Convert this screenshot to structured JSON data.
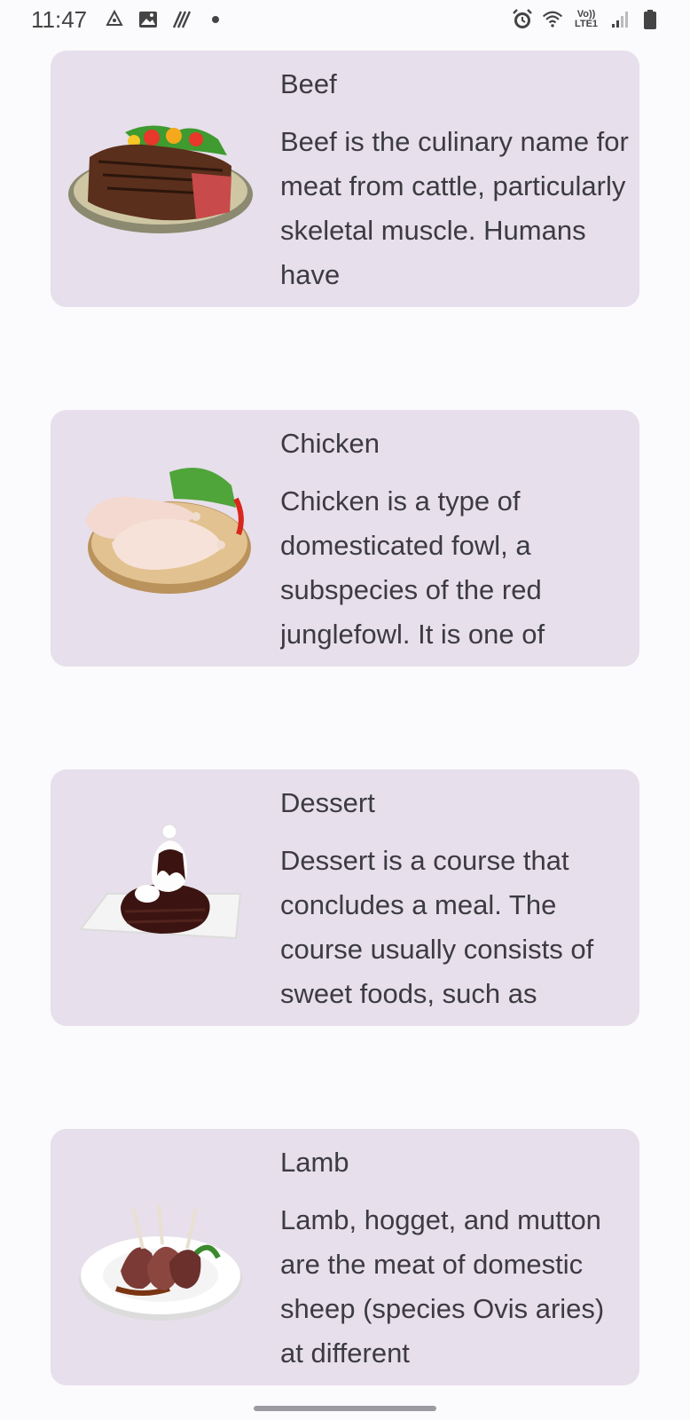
{
  "status_bar": {
    "time": "11:47",
    "left_icons": [
      "recycle-icon",
      "gallery-icon",
      "no-sim-icon",
      "dot-icon"
    ],
    "right_icons": [
      "alarm-icon",
      "wifi-icon",
      "volte-icon",
      "signal-icon",
      "battery-icon"
    ],
    "volte_label": "Vo))",
    "lte_label": "LTE1"
  },
  "cards": [
    {
      "title": "Beef",
      "description": "Beef is the culinary name for meat from cattle, particularly skeletal muscle. Humans have",
      "image": "beef-steak-image"
    },
    {
      "title": "Chicken",
      "description": "Chicken is a type of domesticated fowl, a subspecies of the red junglefowl. It is one of",
      "image": "chicken-legs-image"
    },
    {
      "title": "Dessert",
      "description": "Dessert is a course that concludes a meal. The course usually consists of sweet foods, such as",
      "image": "chocolate-dessert-image"
    },
    {
      "title": "Lamb",
      "description": "Lamb, hogget, and mutton are the meat of domestic sheep (species Ovis aries) at different",
      "image": "lamb-chops-image"
    }
  ],
  "colors": {
    "background": "#fbfafc",
    "card": "#e7dfeb",
    "text": "#3c3b42"
  }
}
